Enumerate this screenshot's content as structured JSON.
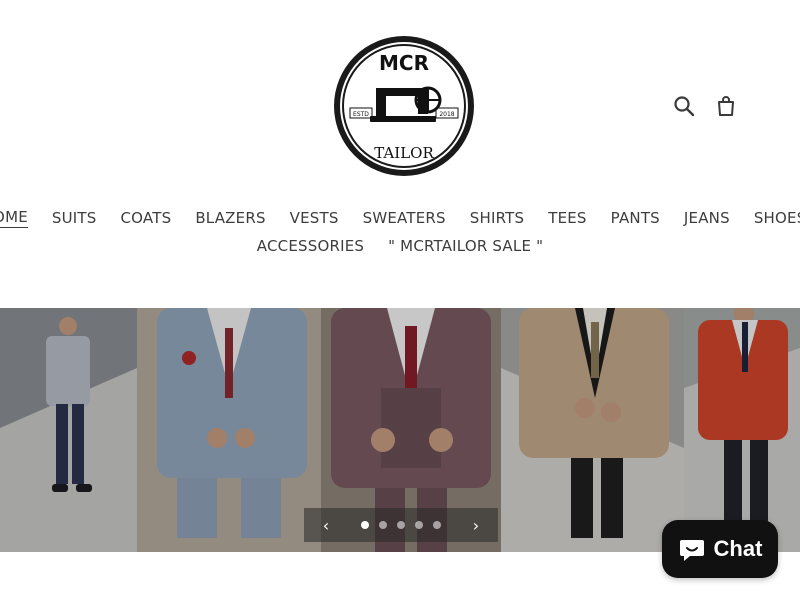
{
  "brand": {
    "logo_icon": "sewing-machine-logo",
    "logo_top_text": "MCR",
    "logo_bottom_text": "TAILOR",
    "logo_estd_label": "ESTD",
    "logo_year": "2018"
  },
  "header": {
    "icons": [
      "search-icon",
      "cart-icon"
    ]
  },
  "nav": {
    "row1": [
      "HOME",
      "SUITS",
      "COATS",
      "BLAZERS",
      "VESTS",
      "SWEATERS",
      "SHIRTS",
      "TEES",
      "PANTS",
      "JEANS",
      "SHOES"
    ],
    "row2": [
      "ACCESSORIES",
      "\" MCRTAILOR SALE \""
    ],
    "active": "HOME"
  },
  "slideshow": {
    "slide_count": 5,
    "active_index": 0,
    "prev_icon": "chevron-left-icon",
    "next_icon": "chevron-right-icon",
    "colors": {
      "suit1": "#aeb4bf",
      "suit2": "#8d9fb8",
      "suit3": "#7a5a60",
      "suit4": "#c5a98a",
      "suit5": "#d0452a",
      "background": "#6b6b6b"
    }
  },
  "chat": {
    "label": "Chat",
    "icon": "chat-bubble-icon"
  }
}
